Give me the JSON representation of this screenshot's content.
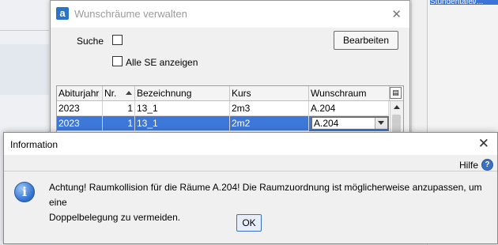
{
  "background": {
    "bluebar_text": "Stundentafel/..."
  },
  "wunsch_dialog": {
    "app_icon_letter": "a",
    "title": "Wunschräume verwalten",
    "close_glyph": "✕",
    "suche_label": "Suche",
    "alle_se_label": "Alle SE anzeigen",
    "bearbeiten_label": "Bearbeiten",
    "table": {
      "headers": [
        "Abiturjahr",
        "Nr.",
        "Bezeichnung",
        "Kurs",
        "Wunschraum"
      ],
      "rows": [
        {
          "abiturjahr": "2023",
          "nr": "1",
          "bezeichnung": "13_1",
          "kurs": "2m3",
          "wunschraum": "A.204"
        },
        {
          "abiturjahr": "2023",
          "nr": "1",
          "bezeichnung": "13_1",
          "kurs": "2m2",
          "wunschraum": "A.204"
        }
      ],
      "selected_row": 1
    }
  },
  "info_dialog": {
    "title": "Information",
    "close_glyph": "✕",
    "hilfe_label": "Hilfe",
    "help_icon_glyph": "?",
    "info_icon_glyph": "i",
    "message_line1": "Achtung! Raumkollision für die Räume A.204! Die Raumzuordnung ist möglicherweise anzupassen, um eine",
    "message_line2": "Doppelbelegung zu vermeiden.",
    "ok_label": "OK"
  },
  "colors": {
    "selection": "#3d78d8",
    "app_icon": "#2a73c7",
    "info_icon": "#2e6ecc"
  }
}
